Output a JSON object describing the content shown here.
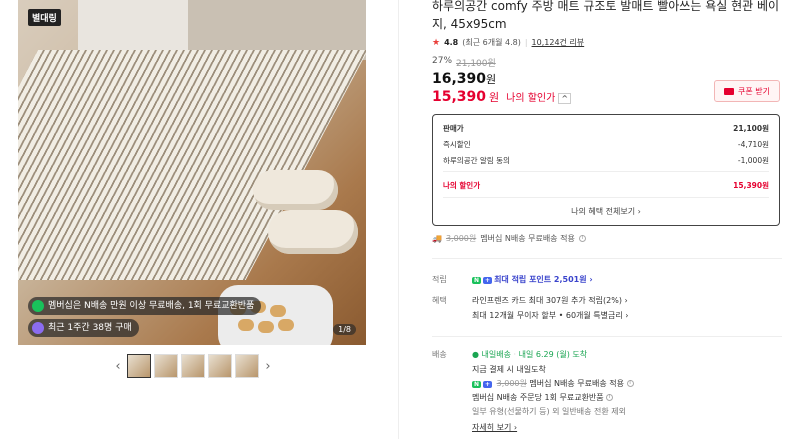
{
  "gallery": {
    "badge": "별대링",
    "overlay_member": "멤버십은 N배송 만원 이상 무료배송, 1회 무료교환반품",
    "overlay_purchase": "최근 1주간 38명 구매",
    "counter": "1/8",
    "thumbnail_count": 5,
    "prev_arrow": "‹",
    "next_arrow": "›"
  },
  "product": {
    "title": "하루의공간 comfy 주방 매트 규조토 발매트 빨아쓰는 욕실 현관 베이지, 45x95cm",
    "rating_score": "4.8",
    "rating_recent": "(최근 6개월 4.8)",
    "review_count": "10,124건 리뷰",
    "discount_pct": "27%",
    "original_price": "21,100원",
    "sale_price": "16,390",
    "my_price": "15,390",
    "won": "원",
    "my_price_label": "나의 할인가",
    "coupon_label": "쿠폰 받기"
  },
  "breakdown": {
    "rows": [
      {
        "label": "판매가",
        "value": "21,100원"
      },
      {
        "label": "즉시할인",
        "value": "-4,710원"
      },
      {
        "label": "하루의공간 알림 동의",
        "value": "-1,000원"
      }
    ],
    "mine_label": "나의 할인가",
    "mine_value": "15,390원",
    "more_link": "나의 혜택 전체보기 ›"
  },
  "membership_shipping": {
    "prefix": "멤버십 N배송 무료배송 적용",
    "strike": "3,000원"
  },
  "points": {
    "label": "적립",
    "text": "최대 적립 포인트 2,501원 ›"
  },
  "benefits": {
    "label": "혜택",
    "line1": "라인프렌즈 카드 최대 307원 추가 적립(2%) ›",
    "line2": "최대 12개월 무이자 할부 • 60개월 특별금리 ›"
  },
  "delivery": {
    "label": "배송",
    "tomorrow_badge": "내일배송",
    "arrival": "내일 6.29 (월) 도착",
    "line1": "지금 결제 시 내일도착",
    "line2_strike": "3,000원",
    "line2_rest": "멤버십 N배송 무료배송 적용",
    "line3": "멤버십 N배송 주문당 1회 무료교환반품",
    "line4": "일부 유형(선물하기 등) 외 일반배송 전환 제외",
    "detail_link": "자세히 보기 ›"
  }
}
